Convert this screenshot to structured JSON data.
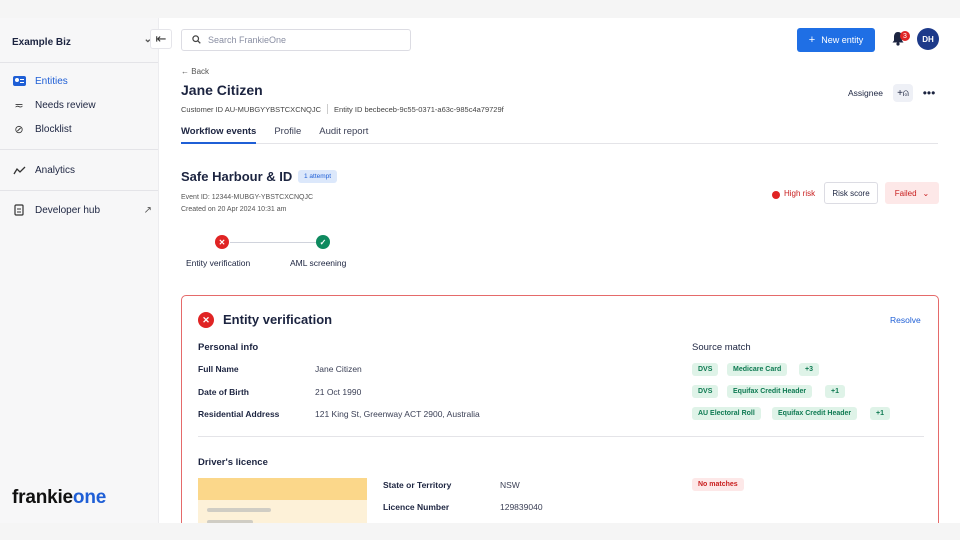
{
  "sidebar": {
    "org_name": "Example Biz",
    "items": [
      {
        "label": "Entities",
        "icon": "entities-icon"
      },
      {
        "label": "Needs review",
        "icon": "needs-review-icon"
      },
      {
        "label": "Blocklist",
        "icon": "blocklist-icon"
      },
      {
        "label": "Analytics",
        "icon": "analytics-icon"
      },
      {
        "label": "Developer hub",
        "icon": "developer-hub-icon"
      }
    ],
    "logo_main": "frankie",
    "logo_accent": "one"
  },
  "topbar": {
    "search_placeholder": "Search FrankieOne",
    "new_entity_label": "New entity",
    "notification_count": "3",
    "avatar_initials": "DH"
  },
  "entity": {
    "back_label": "Back",
    "name": "Jane Citizen",
    "customer_id": "Customer ID AU-MUBGYYBSTCXCNQJC",
    "entity_id": "Entity ID becbeceb-9c55-0371-a63c-985c4a79729f",
    "assignee_label": "Assignee"
  },
  "tabs": [
    {
      "label": "Workflow events",
      "active": true
    },
    {
      "label": "Profile",
      "active": false
    },
    {
      "label": "Audit report",
      "active": false
    }
  ],
  "workflow": {
    "title": "Safe Harbour & ID",
    "attempt_badge": "1 attempt",
    "event_id": "Event ID: 12344-MUBGY-YBSTCXCNQJC",
    "created": "Created on 20 Apr 2024 10:31 am",
    "risk_label": "High risk",
    "risk_score_label": "Risk score",
    "status_label": "Failed",
    "steps": [
      {
        "label": "Entity verification",
        "status": "failed"
      },
      {
        "label": "AML screening",
        "status": "passed"
      }
    ]
  },
  "verification": {
    "title": "Entity verification",
    "resolve_label": "Resolve",
    "personal_info_heading": "Personal info",
    "source_match_heading": "Source match",
    "rows": [
      {
        "label": "Full Name",
        "value": "Jane Citizen"
      },
      {
        "label": "Date of Birth",
        "value": "21 Oct 1990"
      },
      {
        "label": "Residential Address",
        "value": "121 King St, Greenway ACT 2900, Australia"
      }
    ],
    "source_chips": [
      [
        "DVS",
        "Medicare Card",
        "+3"
      ],
      [
        "DVS",
        "Equifax Credit Header",
        "+1"
      ],
      [
        "AU Electoral Roll",
        "Equifax Credit Header",
        "+1"
      ]
    ],
    "licence_heading": "Driver's licence",
    "licence_rows": [
      {
        "label": "State or Territory",
        "value": "NSW"
      },
      {
        "label": "Licence Number",
        "value": "129839040"
      }
    ],
    "licence_match": "No matches"
  },
  "colors": {
    "accent": "#1f5fd6",
    "danger": "#e02424",
    "success": "#0e8a5f"
  }
}
